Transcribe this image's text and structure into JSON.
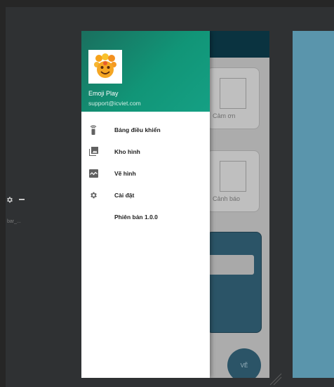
{
  "drawer": {
    "app_name": "Emoji Play",
    "email": "support@icviet.com",
    "items": [
      {
        "label": "Bảng điều khiển",
        "icon": "remote-control-icon"
      },
      {
        "label": "Kho hình",
        "icon": "photo-library-icon"
      },
      {
        "label": "Vẽ hình",
        "icon": "chart-wave-icon"
      },
      {
        "label": "Cài đặt",
        "icon": "gear-icon"
      },
      {
        "label": "Phiên bản 1.0.0",
        "icon": ""
      }
    ]
  },
  "background_cards": [
    {
      "label": "Cảm ơn"
    },
    {
      "label": "Cảnh báo"
    }
  ],
  "fab_label": "VẼ",
  "dock_label": "bar_...",
  "colors": {
    "toolbar": "#0a3340",
    "drawer_header": "#119577",
    "panel": "#2b5467",
    "right_panel": "#5a95ac"
  }
}
